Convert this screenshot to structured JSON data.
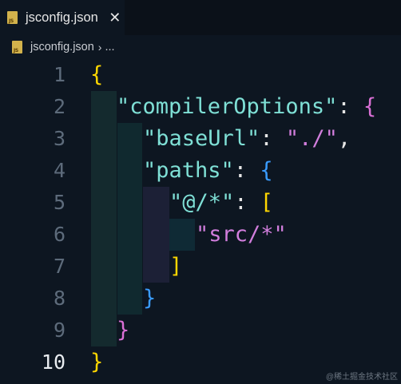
{
  "tab": {
    "label": "jsconfig.json",
    "close": "✕",
    "icon": "js-file-icon",
    "icon_text": "JS"
  },
  "breadcrumb": {
    "file": "jsconfig.json",
    "separator": "›",
    "more": "..."
  },
  "colors": {
    "background": "#0d1621",
    "key": "#7fe0d6",
    "string": "#d27edd",
    "bracket_level1": "#ffd700",
    "bracket_level2": "#da70d6",
    "bracket_level3": "#3a9cff"
  },
  "editor": {
    "active_line": 10,
    "lines": [
      {
        "n": "1",
        "tokens": [
          {
            "t": "{",
            "c": "b1"
          }
        ]
      },
      {
        "n": "2",
        "tokens": [
          {
            "t": "\"compilerOptions\"",
            "c": "key"
          },
          {
            "t": ": ",
            "c": "punc"
          },
          {
            "t": "{",
            "c": "b2"
          }
        ]
      },
      {
        "n": "3",
        "tokens": [
          {
            "t": "\"baseUrl\"",
            "c": "key"
          },
          {
            "t": ": ",
            "c": "punc"
          },
          {
            "t": "\"./\"",
            "c": "str"
          },
          {
            "t": ",",
            "c": "punc"
          }
        ]
      },
      {
        "n": "4",
        "tokens": [
          {
            "t": "\"paths\"",
            "c": "key"
          },
          {
            "t": ": ",
            "c": "punc"
          },
          {
            "t": "{",
            "c": "b3"
          }
        ]
      },
      {
        "n": "5",
        "tokens": [
          {
            "t": "\"@/*\"",
            "c": "key"
          },
          {
            "t": ": ",
            "c": "punc"
          },
          {
            "t": "[",
            "c": "b1"
          }
        ]
      },
      {
        "n": "6",
        "tokens": [
          {
            "t": "\"src/*\"",
            "c": "str"
          }
        ]
      },
      {
        "n": "7",
        "tokens": [
          {
            "t": "]",
            "c": "b1"
          }
        ]
      },
      {
        "n": "8",
        "tokens": [
          {
            "t": "}",
            "c": "b3"
          }
        ]
      },
      {
        "n": "9",
        "tokens": [
          {
            "t": "}",
            "c": "b2"
          }
        ]
      },
      {
        "n": "10",
        "tokens": [
          {
            "t": "}",
            "c": "b1"
          }
        ]
      }
    ]
  },
  "watermark": "@稀土掘金技术社区"
}
